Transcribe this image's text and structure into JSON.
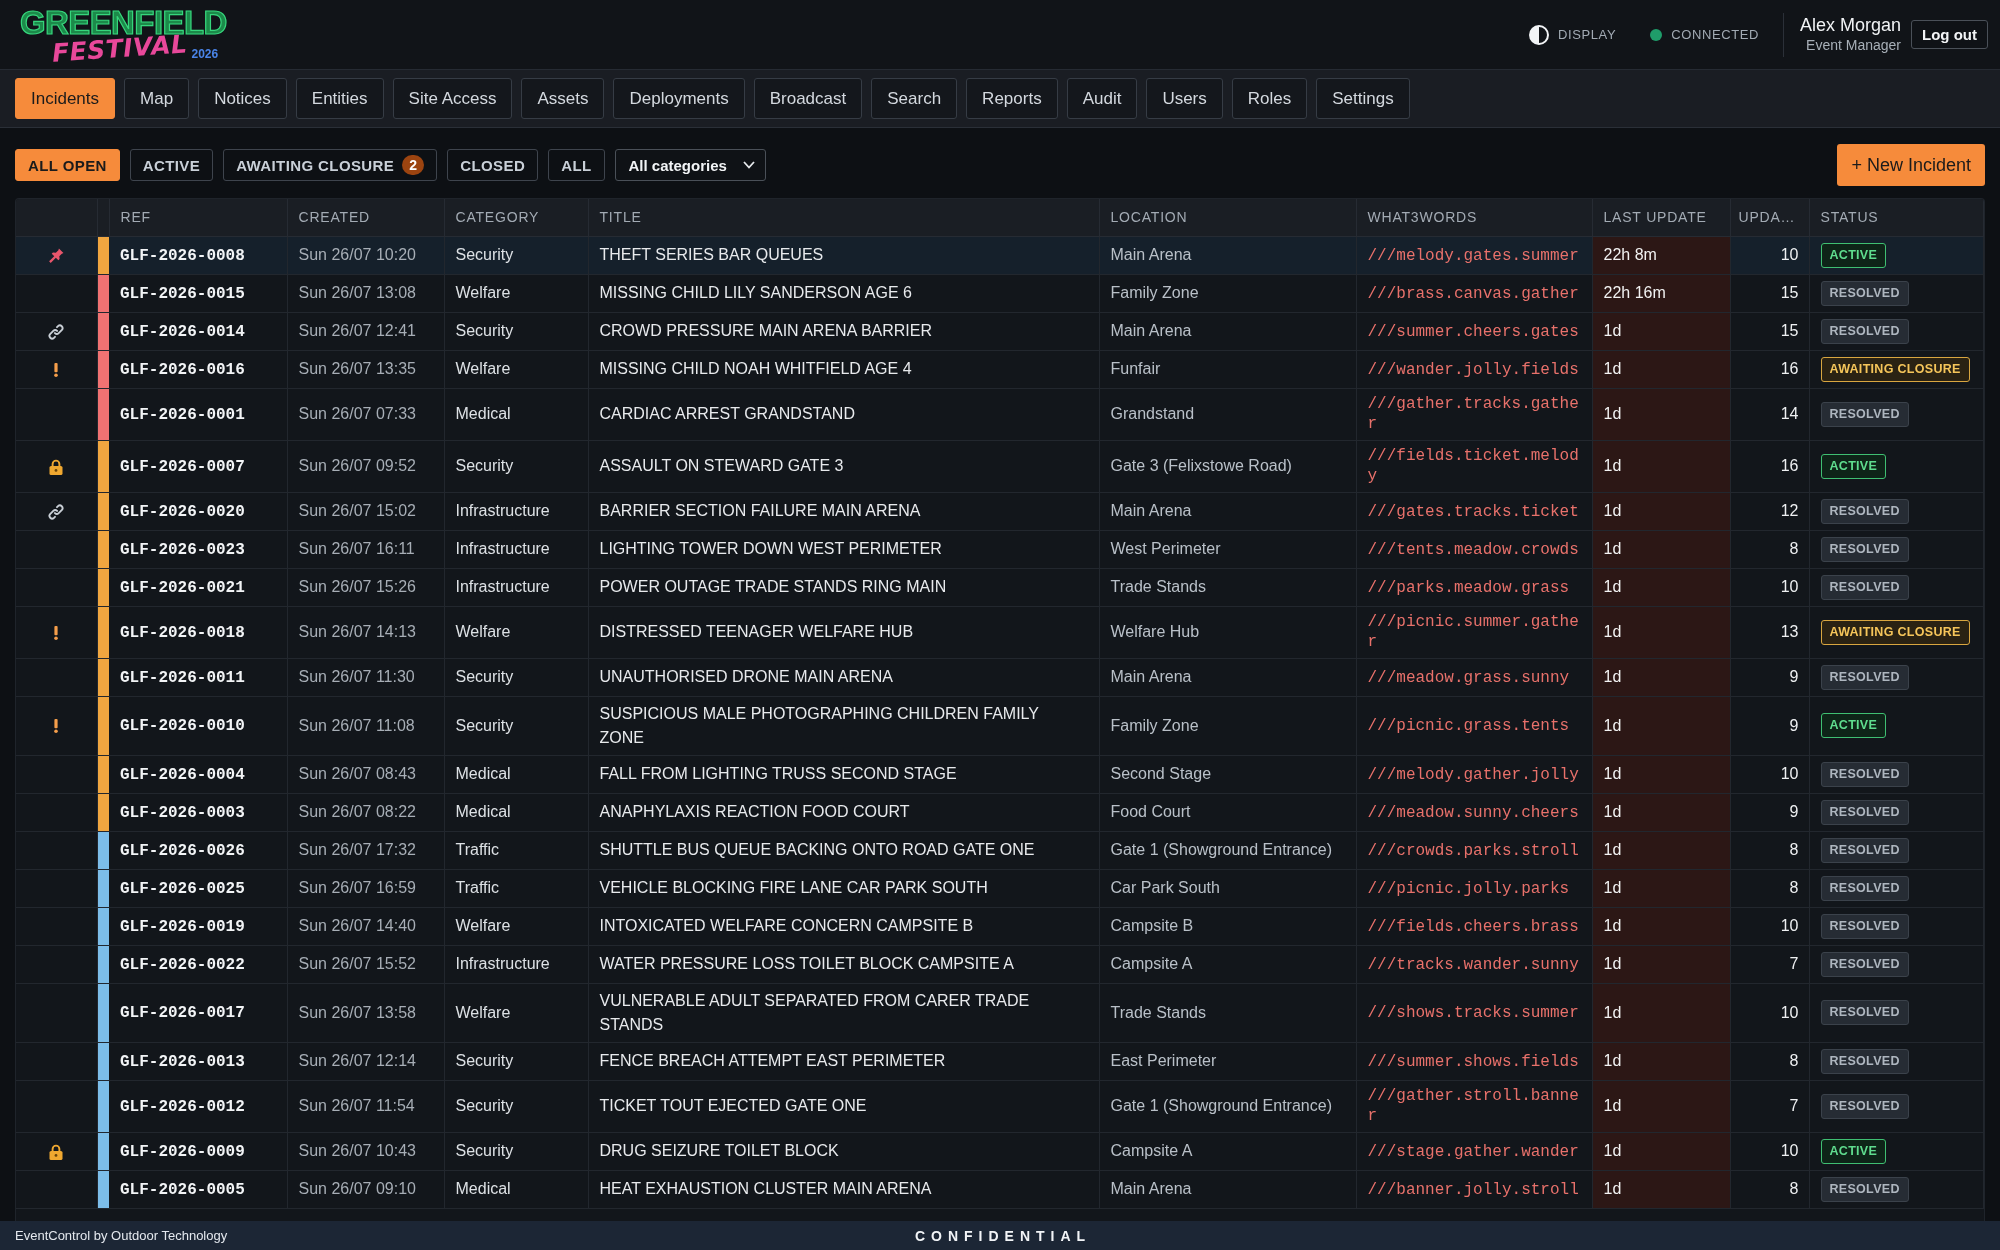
{
  "header": {
    "logo": {
      "line_1": "GREENFIELD",
      "line_2": "FESTIVAL",
      "year": "2026"
    },
    "display_toggle": {
      "label": "DISPLAY"
    },
    "connection": {
      "label": "CONNECTED",
      "connected": true
    },
    "user": {
      "name": "Alex Morgan",
      "role": "Event Manager"
    },
    "logout_button": "Log out"
  },
  "nav_tabs": [
    {
      "label": "Incidents",
      "selected": true
    },
    {
      "label": "Map",
      "selected": false
    },
    {
      "label": "Notices",
      "selected": false
    },
    {
      "label": "Entities",
      "selected": false
    },
    {
      "label": "Site Access",
      "selected": false
    },
    {
      "label": "Assets",
      "selected": false
    },
    {
      "label": "Deployments",
      "selected": false
    },
    {
      "label": "Broadcast",
      "selected": false
    },
    {
      "label": "Search",
      "selected": false
    },
    {
      "label": "Reports",
      "selected": false
    },
    {
      "label": "Audit",
      "selected": false
    },
    {
      "label": "Users",
      "selected": false
    },
    {
      "label": "Roles",
      "selected": false
    },
    {
      "label": "Settings",
      "selected": false
    }
  ],
  "filters": {
    "status_filters": [
      {
        "label": "ALL OPEN",
        "selected": true
      },
      {
        "label": "ACTIVE",
        "selected": false
      },
      {
        "label": "AWAITING CLOSURE",
        "selected": false,
        "count": "2"
      },
      {
        "label": "CLOSED",
        "selected": false
      },
      {
        "label": "ALL",
        "selected": false
      }
    ],
    "category_dropdown": {
      "value": "All categories"
    },
    "new_button": "+ New Incident"
  },
  "table": {
    "columns": [
      "REF",
      "CREATED",
      "CATEGORY",
      "TITLE",
      "LOCATION",
      "WHAT3WORDS",
      "LAST UPDATE",
      "UPDA…",
      "STATUS"
    ],
    "rows": [
      {
        "selected": true,
        "marker": {
          "kind": "pin"
        },
        "color": "#f0a640",
        "ref": "GLF-2026-0008",
        "created": "Sun 26/07 10:20",
        "category": "Security",
        "title": "THEFT SERIES BAR QUEUES",
        "location": "Main Arena",
        "what3words": "///melody.gates.summer",
        "last_update": "22h 8m",
        "overdue": true,
        "updates": "10",
        "status": {
          "label": "ACTIVE",
          "kind": "active"
        }
      },
      {
        "selected": false,
        "color": "#f07272",
        "ref": "GLF-2026-0015",
        "created": "Sun 26/07 13:08",
        "category": "Welfare",
        "title": "MISSING CHILD LILY SANDERSON AGE 6",
        "location": "Family Zone",
        "what3words": "///brass.canvas.gather",
        "last_update": "22h 16m",
        "overdue": true,
        "updates": "15",
        "status": {
          "label": "RESOLVED",
          "kind": "resolved"
        }
      },
      {
        "selected": false,
        "marker": {
          "kind": "link"
        },
        "color": "#f07272",
        "ref": "GLF-2026-0014",
        "created": "Sun 26/07 12:41",
        "category": "Security",
        "title": "CROWD PRESSURE MAIN ARENA BARRIER",
        "location": "Main Arena",
        "what3words": "///summer.cheers.gates",
        "last_update": "1d",
        "overdue": true,
        "updates": "15",
        "status": {
          "label": "RESOLVED",
          "kind": "resolved"
        }
      },
      {
        "selected": false,
        "marker": {
          "kind": "alert"
        },
        "color": "#f07272",
        "ref": "GLF-2026-0016",
        "created": "Sun 26/07 13:35",
        "category": "Welfare",
        "title": "MISSING CHILD NOAH WHITFIELD AGE 4",
        "location": "Funfair",
        "what3words": "///wander.jolly.fields",
        "last_update": "1d",
        "overdue": true,
        "updates": "16",
        "status": {
          "label": "AWAITING CLOSURE",
          "kind": "awaiting"
        }
      },
      {
        "selected": false,
        "color": "#f07272",
        "ref": "GLF-2026-0001",
        "created": "Sun 26/07 07:33",
        "category": "Medical",
        "title": "CARDIAC ARREST GRANDSTAND",
        "location": "Grandstand",
        "what3words": "///gather.tracks.gather",
        "last_update": "1d",
        "overdue": true,
        "updates": "14",
        "status": {
          "label": "RESOLVED",
          "kind": "resolved"
        }
      },
      {
        "selected": false,
        "marker": {
          "kind": "lock"
        },
        "color": "#f0a640",
        "ref": "GLF-2026-0007",
        "created": "Sun 26/07 09:52",
        "category": "Security",
        "title": "ASSAULT ON STEWARD GATE 3",
        "location": "Gate 3 (Felixstowe Road)",
        "what3words": "///fields.ticket.melody",
        "last_update": "1d",
        "overdue": true,
        "updates": "16",
        "status": {
          "label": "ACTIVE",
          "kind": "active"
        }
      },
      {
        "selected": false,
        "marker": {
          "kind": "link"
        },
        "color": "#f0a640",
        "ref": "GLF-2026-0020",
        "created": "Sun 26/07 15:02",
        "category": "Infrastructure",
        "title": "BARRIER SECTION FAILURE MAIN ARENA",
        "location": "Main Arena",
        "what3words": "///gates.tracks.ticket",
        "last_update": "1d",
        "overdue": true,
        "updates": "12",
        "status": {
          "label": "RESOLVED",
          "kind": "resolved"
        }
      },
      {
        "selected": false,
        "color": "#f0a640",
        "ref": "GLF-2026-0023",
        "created": "Sun 26/07 16:11",
        "category": "Infrastructure",
        "title": "LIGHTING TOWER DOWN WEST PERIMETER",
        "location": "West Perimeter",
        "what3words": "///tents.meadow.crowds",
        "last_update": "1d",
        "overdue": true,
        "updates": "8",
        "status": {
          "label": "RESOLVED",
          "kind": "resolved"
        }
      },
      {
        "selected": false,
        "color": "#f0a640",
        "ref": "GLF-2026-0021",
        "created": "Sun 26/07 15:26",
        "category": "Infrastructure",
        "title": "POWER OUTAGE TRADE STANDS RING MAIN",
        "location": "Trade Stands",
        "what3words": "///parks.meadow.grass",
        "last_update": "1d",
        "overdue": true,
        "updates": "10",
        "status": {
          "label": "RESOLVED",
          "kind": "resolved"
        }
      },
      {
        "selected": false,
        "marker": {
          "kind": "alert"
        },
        "color": "#f0a640",
        "ref": "GLF-2026-0018",
        "created": "Sun 26/07 14:13",
        "category": "Welfare",
        "title": "DISTRESSED TEENAGER WELFARE HUB",
        "location": "Welfare Hub",
        "what3words": "///picnic.summer.gather",
        "last_update": "1d",
        "overdue": true,
        "updates": "13",
        "status": {
          "label": "AWAITING CLOSURE",
          "kind": "awaiting"
        }
      },
      {
        "selected": false,
        "color": "#f0a640",
        "ref": "GLF-2026-0011",
        "created": "Sun 26/07 11:30",
        "category": "Security",
        "title": "UNAUTHORISED DRONE MAIN ARENA",
        "location": "Main Arena",
        "what3words": "///meadow.grass.sunny",
        "last_update": "1d",
        "overdue": true,
        "updates": "9",
        "status": {
          "label": "RESOLVED",
          "kind": "resolved"
        }
      },
      {
        "selected": false,
        "marker": {
          "kind": "alert"
        },
        "color": "#f0a640",
        "ref": "GLF-2026-0010",
        "created": "Sun 26/07 11:08",
        "category": "Security",
        "title": "SUSPICIOUS MALE PHOTOGRAPHING CHILDREN FAMILY ZONE",
        "location": "Family Zone",
        "what3words": "///picnic.grass.tents",
        "last_update": "1d",
        "overdue": true,
        "updates": "9",
        "status": {
          "label": "ACTIVE",
          "kind": "active"
        }
      },
      {
        "selected": false,
        "color": "#f0a640",
        "ref": "GLF-2026-0004",
        "created": "Sun 26/07 08:43",
        "category": "Medical",
        "title": "FALL FROM LIGHTING TRUSS SECOND STAGE",
        "location": "Second Stage",
        "what3words": "///melody.gather.jolly",
        "last_update": "1d",
        "overdue": true,
        "updates": "10",
        "status": {
          "label": "RESOLVED",
          "kind": "resolved"
        }
      },
      {
        "selected": false,
        "color": "#f0a640",
        "ref": "GLF-2026-0003",
        "created": "Sun 26/07 08:22",
        "category": "Medical",
        "title": "ANAPHYLAXIS REACTION FOOD COURT",
        "location": "Food Court",
        "what3words": "///meadow.sunny.cheers",
        "last_update": "1d",
        "overdue": true,
        "updates": "9",
        "status": {
          "label": "RESOLVED",
          "kind": "resolved"
        }
      },
      {
        "selected": false,
        "color": "#7cbde9",
        "ref": "GLF-2026-0026",
        "created": "Sun 26/07 17:32",
        "category": "Traffic",
        "title": "SHUTTLE BUS QUEUE BACKING ONTO ROAD GATE ONE",
        "location": "Gate 1 (Showground Entrance)",
        "what3words": "///crowds.parks.stroll",
        "last_update": "1d",
        "overdue": true,
        "updates": "8",
        "status": {
          "label": "RESOLVED",
          "kind": "resolved"
        }
      },
      {
        "selected": false,
        "color": "#7cbde9",
        "ref": "GLF-2026-0025",
        "created": "Sun 26/07 16:59",
        "category": "Traffic",
        "title": "VEHICLE BLOCKING FIRE LANE CAR PARK SOUTH",
        "location": "Car Park South",
        "what3words": "///picnic.jolly.parks",
        "last_update": "1d",
        "overdue": true,
        "updates": "8",
        "status": {
          "label": "RESOLVED",
          "kind": "resolved"
        }
      },
      {
        "selected": false,
        "color": "#7cbde9",
        "ref": "GLF-2026-0019",
        "created": "Sun 26/07 14:40",
        "category": "Welfare",
        "title": "INTOXICATED WELFARE CONCERN CAMPSITE B",
        "location": "Campsite B",
        "what3words": "///fields.cheers.brass",
        "last_update": "1d",
        "overdue": true,
        "updates": "10",
        "status": {
          "label": "RESOLVED",
          "kind": "resolved"
        }
      },
      {
        "selected": false,
        "color": "#7cbde9",
        "ref": "GLF-2026-0022",
        "created": "Sun 26/07 15:52",
        "category": "Infrastructure",
        "title": "WATER PRESSURE LOSS TOILET BLOCK CAMPSITE A",
        "location": "Campsite A",
        "what3words": "///tracks.wander.sunny",
        "last_update": "1d",
        "overdue": true,
        "updates": "7",
        "status": {
          "label": "RESOLVED",
          "kind": "resolved"
        }
      },
      {
        "selected": false,
        "color": "#7cbde9",
        "ref": "GLF-2026-0017",
        "created": "Sun 26/07 13:58",
        "category": "Welfare",
        "title": "VULNERABLE ADULT SEPARATED FROM CARER TRADE STANDS",
        "location": "Trade Stands",
        "what3words": "///shows.tracks.summer",
        "last_update": "1d",
        "overdue": true,
        "updates": "10",
        "status": {
          "label": "RESOLVED",
          "kind": "resolved"
        }
      },
      {
        "selected": false,
        "color": "#7cbde9",
        "ref": "GLF-2026-0013",
        "created": "Sun 26/07 12:14",
        "category": "Security",
        "title": "FENCE BREACH ATTEMPT EAST PERIMETER",
        "location": "East Perimeter",
        "what3words": "///summer.shows.fields",
        "last_update": "1d",
        "overdue": true,
        "updates": "8",
        "status": {
          "label": "RESOLVED",
          "kind": "resolved"
        }
      },
      {
        "selected": false,
        "color": "#7cbde9",
        "ref": "GLF-2026-0012",
        "created": "Sun 26/07 11:54",
        "category": "Security",
        "title": "TICKET TOUT EJECTED GATE ONE",
        "location": "Gate 1 (Showground Entrance)",
        "what3words": "///gather.stroll.banner",
        "last_update": "1d",
        "overdue": true,
        "updates": "7",
        "status": {
          "label": "RESOLVED",
          "kind": "resolved"
        }
      },
      {
        "selected": false,
        "marker": {
          "kind": "lock"
        },
        "color": "#7cbde9",
        "ref": "GLF-2026-0009",
        "created": "Sun 26/07 10:43",
        "category": "Security",
        "title": "DRUG SEIZURE TOILET BLOCK",
        "location": "Campsite A",
        "what3words": "///stage.gather.wander",
        "last_update": "1d",
        "overdue": true,
        "updates": "10",
        "status": {
          "label": "ACTIVE",
          "kind": "active"
        }
      },
      {
        "selected": false,
        "color": "#7cbde9",
        "ref": "GLF-2026-0005",
        "created": "Sun 26/07 09:10",
        "category": "Medical",
        "title": "HEAT EXHAUSTION CLUSTER MAIN ARENA",
        "location": "Main Arena",
        "what3words": "///banner.jolly.stroll",
        "last_update": "1d",
        "overdue": true,
        "updates": "8",
        "status": {
          "label": "RESOLVED",
          "kind": "resolved"
        }
      }
    ]
  },
  "footer": {
    "credit": "EventControl by Outdoor Technology",
    "classification": "CONFIDENTIAL"
  }
}
